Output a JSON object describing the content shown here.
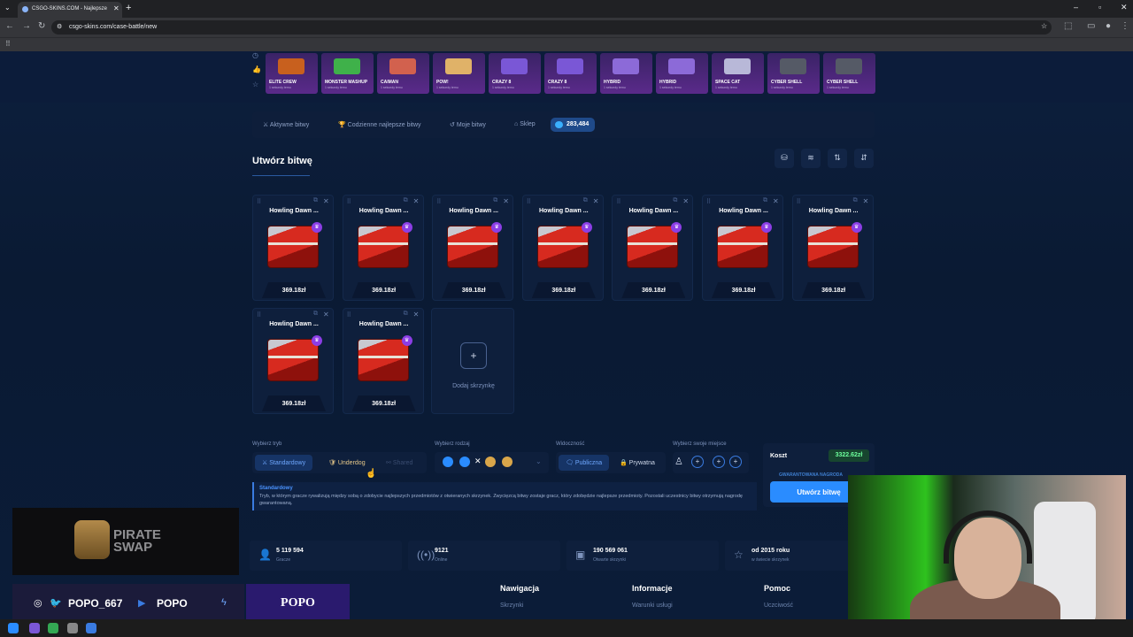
{
  "browser": {
    "tab_title": "CSGO-SKINS.COM - Najlepsze",
    "url": "csgo-skins.com/case-battle/new"
  },
  "top_skins": [
    {
      "name": "ELITE CREW",
      "sub": "1 sekundy temu",
      "color": "#c8601e"
    },
    {
      "name": "MONSTER MASHUP",
      "sub": "1 sekundy temu",
      "color": "#3fb14a"
    },
    {
      "name": "CAIMAN",
      "sub": "1 sekundy temu",
      "color": "#d2614e"
    },
    {
      "name": "POW!",
      "sub": "1 sekundy temu",
      "color": "#e0b268"
    },
    {
      "name": "CRAZY 8",
      "sub": "1 sekundy temu",
      "color": "#7a57d6"
    },
    {
      "name": "CRAZY 8",
      "sub": "1 sekundy temu",
      "color": "#7a57d6"
    },
    {
      "name": "HYBRID",
      "sub": "1 sekundy temu",
      "color": "#8c6ad8"
    },
    {
      "name": "HYBRID",
      "sub": "1 sekundy temu",
      "color": "#8c6ad8"
    },
    {
      "name": "SPACE CAT",
      "sub": "1 sekundy temu",
      "color": "#b8b8d8"
    },
    {
      "name": "CYBER SHELL",
      "sub": "1 sekundy temu",
      "color": "#555a66"
    },
    {
      "name": "CYBER SHELL",
      "sub": "1 sekundy temu",
      "color": "#555a66"
    }
  ],
  "menu": {
    "active": "Aktywne bitwy",
    "daily": "Codzienne najlepsze bitwy",
    "mine": "Moje bitwy",
    "shop": "Sklep",
    "balance": "283,484"
  },
  "title": "Utwórz bitwę",
  "cases": [
    {
      "name": "Howling Dawn ...",
      "price": "369.18zł"
    },
    {
      "name": "Howling Dawn ...",
      "price": "369.18zł"
    },
    {
      "name": "Howling Dawn ...",
      "price": "369.18zł"
    },
    {
      "name": "Howling Dawn ...",
      "price": "369.18zł"
    },
    {
      "name": "Howling Dawn ...",
      "price": "369.18zł"
    },
    {
      "name": "Howling Dawn ...",
      "price": "369.18zł"
    },
    {
      "name": "Howling Dawn ...",
      "price": "369.18zł"
    },
    {
      "name": "Howling Dawn ...",
      "price": "369.18zł"
    },
    {
      "name": "Howling Dawn ...",
      "price": "369.18zł"
    }
  ],
  "add_case_label": "Dodaj skrzynkę",
  "options": {
    "mode_label": "Wybierz tryb",
    "mode_standard": "Standardowy",
    "mode_underdog": "Underdog",
    "mode_shared": "Shared",
    "type_label": "Wybierz rodzaj",
    "visibility_label": "Widoczność",
    "vis_public": "Publiczna",
    "vis_private": "Prywatna",
    "seat_label": "Wybierz swoje miejsce"
  },
  "description": {
    "title": "Standardowy",
    "body": "Tryb, w którym gracze rywalizują między sobą o zdobycie najlepszych przedmiotów z otwieranych skrzynek. Zwycięzcą bitwy zostaje gracz, który zdobędzie najlepsze przedmioty. Pozostali uczestnicy bitwy otrzymują nagrodę gwarantowaną."
  },
  "cost": {
    "label": "Koszt",
    "value": "3322.62zł",
    "guaranteed": "GWARANTOWANA NAGRODA",
    "create": "Utwórz bitwę"
  },
  "stats": [
    {
      "value": "5 119 594",
      "label": "Gracze",
      "icon": "user-icon",
      "glyph": "👤"
    },
    {
      "value": "9121",
      "label": "Online",
      "icon": "signal-icon",
      "glyph": "((•))"
    },
    {
      "value": "190 569 061",
      "label": "Otwarte skrzynki",
      "icon": "box-icon",
      "glyph": "▣"
    },
    {
      "value": "od 2015 roku",
      "label": "w świecie skrzynek",
      "icon": "star-icon",
      "glyph": "☆"
    }
  ],
  "footer": {
    "nav": "Nawigacja",
    "nav_link": "Skrzynki",
    "info": "Informacje",
    "info_link": "Warunki usługi",
    "help": "Pomoc",
    "help_link": "Uczciwość"
  },
  "overlay": {
    "brand_line1": "PIRATE",
    "brand_line2": "SWAP",
    "handle1": "POPO_667",
    "handle2": "POPO",
    "popo": "POPO"
  }
}
